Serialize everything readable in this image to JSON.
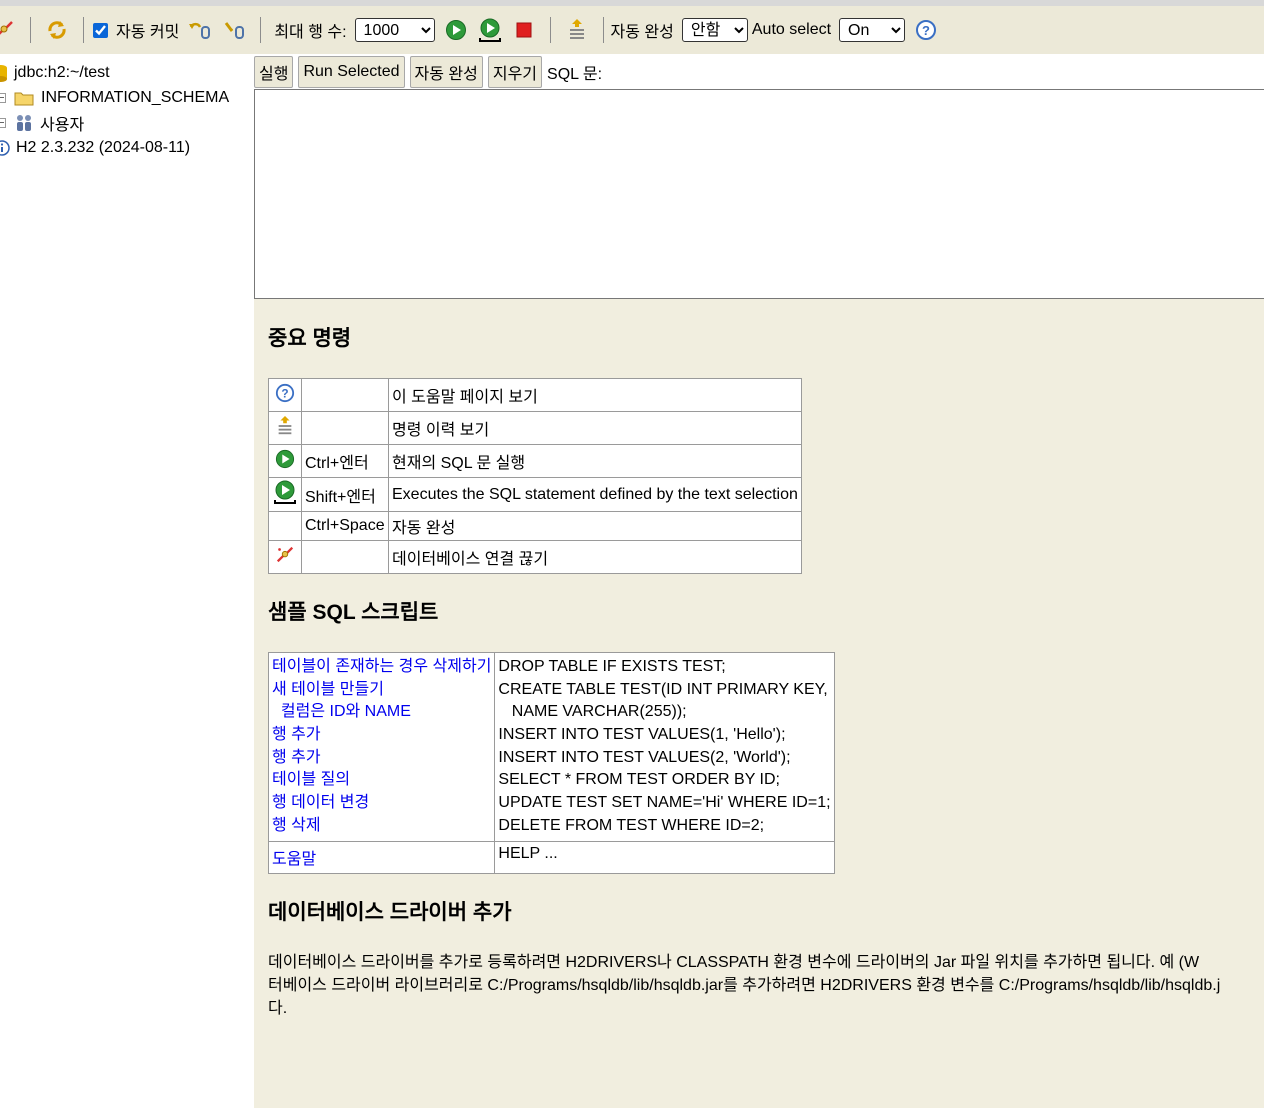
{
  "toolbar": {
    "autocommit_label": "자동 커밋",
    "autocommit_checked": true,
    "max_rows_label": "최대 행 수:",
    "max_rows_value": "1000",
    "autocomplete_label": "자동 완성",
    "autocomplete_value": "안함",
    "autoselect_label": "Auto select",
    "autoselect_value": "On"
  },
  "tree": {
    "connection": "jdbc:h2:~/test",
    "schema": "INFORMATION_SCHEMA",
    "users": "사용자",
    "version": "H2 2.3.232 (2024-08-11)"
  },
  "query": {
    "run_label": "실행",
    "run_selected_label": "Run Selected",
    "autocomplete_label": "자동 완성",
    "clear_label": "지우기",
    "sql_label": "SQL 문:"
  },
  "help": {
    "important_title": "중요 명령",
    "commands": [
      {
        "icon": "help-icon",
        "key": "",
        "desc": "이 도움말 페이지 보기"
      },
      {
        "icon": "history-icon",
        "key": "",
        "desc": "명령 이력 보기"
      },
      {
        "icon": "run-icon",
        "key": "Ctrl+엔터",
        "desc": "현재의 SQL 문 실행"
      },
      {
        "icon": "run-selected-icon",
        "key": "Shift+엔터",
        "desc": "Executes the SQL statement defined by the text selection"
      },
      {
        "icon": "",
        "key": "Ctrl+Space",
        "desc": "자동 완성"
      },
      {
        "icon": "disconnect-icon",
        "key": "",
        "desc": "데이터베이스 연결 끊기"
      }
    ],
    "sample_title": "샘플 SQL 스크립트",
    "sample_links": [
      "테이블이 존재하는 경우 삭제하기",
      "새 테이블 만들기",
      "  컬럼은 ID와 NAME",
      "행 추가",
      "행 추가",
      "테이블 질의",
      "행 데이터 변경",
      "행 삭제"
    ],
    "sample_sql": [
      "DROP TABLE IF EXISTS TEST;",
      "CREATE TABLE TEST(ID INT PRIMARY KEY,",
      "   NAME VARCHAR(255));",
      "INSERT INTO TEST VALUES(1, 'Hello');",
      "INSERT INTO TEST VALUES(2, 'World');",
      "SELECT * FROM TEST ORDER BY ID;",
      "UPDATE TEST SET NAME='Hi' WHERE ID=1;",
      "DELETE FROM TEST WHERE ID=2;"
    ],
    "help_link": "도움말",
    "help_sql": "HELP ...",
    "driver_title": "데이터베이스 드라이버 추가",
    "driver_lines": [
      "데이터베이스 드라이버를 추가로 등록하려면 H2DRIVERS나 CLASSPATH 환경 변수에 드라이버의 Jar 파일 위치를 추가하면 됩니다. 예 (W",
      "터베이스 드라이버 라이브러리로 C:/Programs/hsqldb/lib/hsqldb.jar를 추가하려면 H2DRIVERS 환경 변수를 C:/Programs/hsqldb/lib/hsqldb.j",
      "다."
    ]
  },
  "colors": {
    "toolbar_bg": "#ece9d8",
    "help_bg": "#f1eedf",
    "link": "#0000ee",
    "run_green": "#2e9a3a",
    "stop_red": "#e02020",
    "help_blue": "#3a6fc4"
  }
}
